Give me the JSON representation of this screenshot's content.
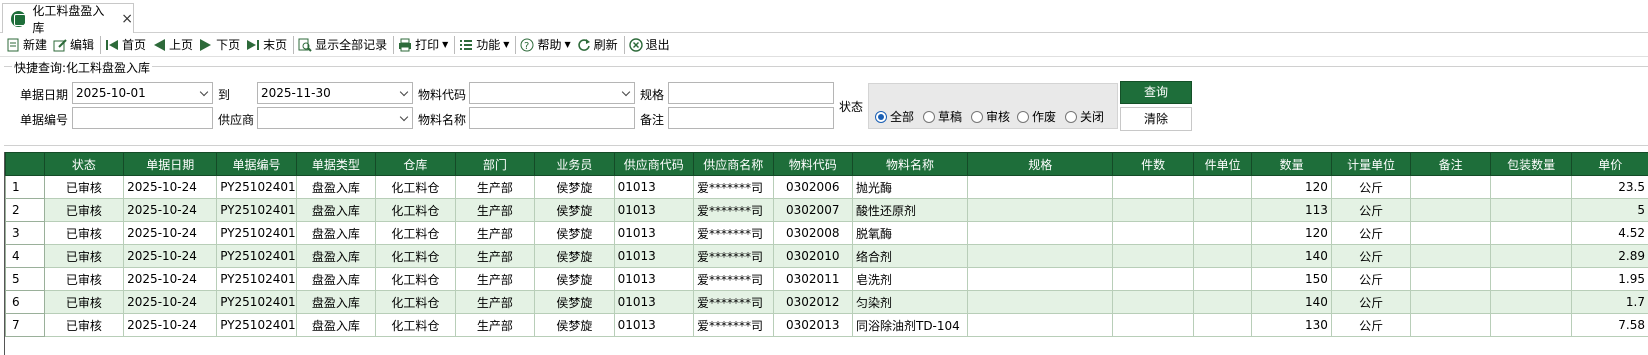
{
  "tab": {
    "title": "化工料盘盈入库",
    "close": "×"
  },
  "toolbar": {
    "new": "新建",
    "edit": "编辑",
    "first": "首页",
    "prev": "上页",
    "next": "下页",
    "last": "末页",
    "show_all": "显示全部记录",
    "print": "打印",
    "function": "功能",
    "help": "帮助",
    "refresh": "刷新",
    "exit": "退出"
  },
  "quick_search": {
    "title": "快捷查询:化工料盘盈入库",
    "date_label": "单据日期",
    "date_from": "2025-10-01",
    "to_label": "到",
    "date_to": "2025-11-30",
    "material_code_label": "物料代码",
    "material_code": "",
    "spec_label": "规格",
    "spec": "",
    "doc_no_label": "单据编号",
    "doc_no": "",
    "supplier_label": "供应商",
    "supplier": "",
    "material_name_label": "物料名称",
    "material_name": "",
    "remark_label": "备注",
    "remark": "",
    "status_label": "状态",
    "status_options": [
      "全部",
      "草稿",
      "审核",
      "作废",
      "关闭"
    ],
    "status_selected": "全部",
    "query_button": "查询",
    "clear_button": "清除"
  },
  "grid": {
    "columns": [
      "状态",
      "单据日期",
      "单据编号",
      "单据类型",
      "仓库",
      "部门",
      "业务员",
      "供应商代码",
      "供应商名称",
      "物料代码",
      "物料名称",
      "规格",
      "件数",
      "件单位",
      "数量",
      "计量单位",
      "备注",
      "包装数量",
      "单价"
    ],
    "rows": [
      [
        "1",
        "已审核",
        "2025-10-24",
        "PY25102401",
        "盘盈入库",
        "化工料仓",
        "生产部",
        "侯梦旋",
        "01013",
        "爱*******司",
        "0302006",
        "抛光酶",
        "",
        "",
        "120",
        "公斤",
        "",
        "",
        "23.5"
      ],
      [
        "2",
        "已审核",
        "2025-10-24",
        "PY25102401",
        "盘盈入库",
        "化工料仓",
        "生产部",
        "侯梦旋",
        "01013",
        "爱*******司",
        "0302007",
        "酸性还原剂",
        "",
        "",
        "113",
        "公斤",
        "",
        "",
        "5"
      ],
      [
        "3",
        "已审核",
        "2025-10-24",
        "PY25102401",
        "盘盈入库",
        "化工料仓",
        "生产部",
        "侯梦旋",
        "01013",
        "爱*******司",
        "0302008",
        "脱氧酶",
        "",
        "",
        "120",
        "公斤",
        "",
        "",
        "4.52"
      ],
      [
        "4",
        "已审核",
        "2025-10-24",
        "PY25102401",
        "盘盈入库",
        "化工料仓",
        "生产部",
        "侯梦旋",
        "01013",
        "爱*******司",
        "0302010",
        "络合剂",
        "",
        "",
        "140",
        "公斤",
        "",
        "",
        "2.89"
      ],
      [
        "5",
        "已审核",
        "2025-10-24",
        "PY25102401",
        "盘盈入库",
        "化工料仓",
        "生产部",
        "侯梦旋",
        "01013",
        "爱*******司",
        "0302011",
        "皂洗剂",
        "",
        "",
        "150",
        "公斤",
        "",
        "",
        "1.95"
      ],
      [
        "6",
        "已审核",
        "2025-10-24",
        "PY25102401",
        "盘盈入库",
        "化工料仓",
        "生产部",
        "侯梦旋",
        "01013",
        "爱*******司",
        "0302012",
        "匀染剂",
        "",
        "",
        "140",
        "公斤",
        "",
        "",
        "1.7"
      ],
      [
        "7",
        "已审核",
        "2025-10-24",
        "PY25102401",
        "盘盈入库",
        "化工料仓",
        "生产部",
        "侯梦旋",
        "01013",
        "爱*******司",
        "0302013",
        "同浴除油剂TD-104",
        "",
        "",
        "130",
        "公斤",
        "",
        "",
        "7.58"
      ]
    ]
  },
  "colors": {
    "header_green": "#1e6e3a",
    "row_alt": "#e4f2e4"
  }
}
